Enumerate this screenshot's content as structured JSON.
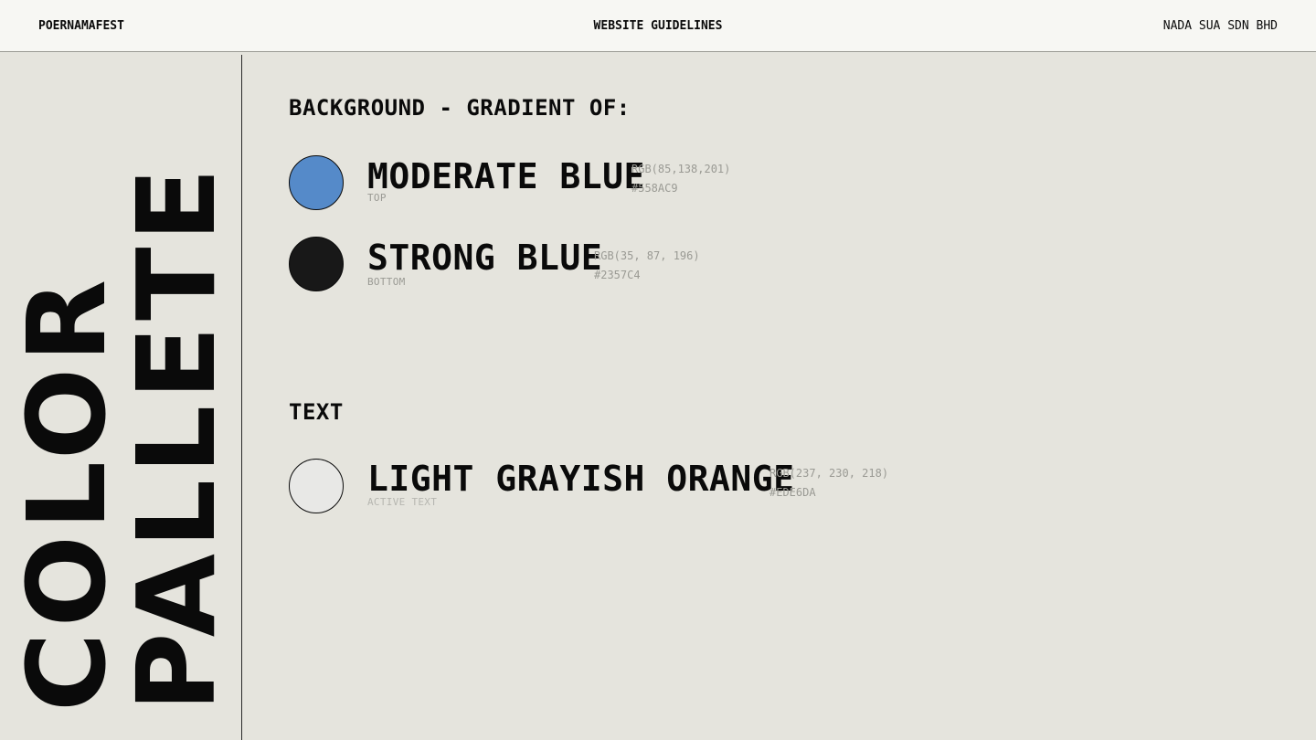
{
  "header": {
    "brand": "POERNAMAFEST",
    "title": "WEBSITE GUIDELINES",
    "company": "NADA SUA SDN BHD"
  },
  "sidebar": {
    "title_line_1": "COLOR",
    "title_line_2": "PALLETE"
  },
  "background_section": {
    "heading": "BACKGROUND - GRADIENT OF:",
    "colors": [
      {
        "name": "MODERATE BLUE",
        "role": "TOP",
        "rgb": "RGB(85,138,201)",
        "hex": "#558AC9",
        "swatch_color": "#558AC9"
      },
      {
        "name": "STRONG BLUE",
        "role": "BOTTOM",
        "rgb": "RGB(35, 87, 196)",
        "hex": "#2357C4",
        "swatch_color": "#181818"
      }
    ]
  },
  "text_section": {
    "heading": "TEXT",
    "colors": [
      {
        "name": "LIGHT GRAYISH ORANGE",
        "role": "ACTIVE TEXT",
        "rgb": "RGB(237, 230, 218)",
        "hex": "#EDE6DA",
        "swatch_color": "#e8e8e6"
      }
    ]
  }
}
